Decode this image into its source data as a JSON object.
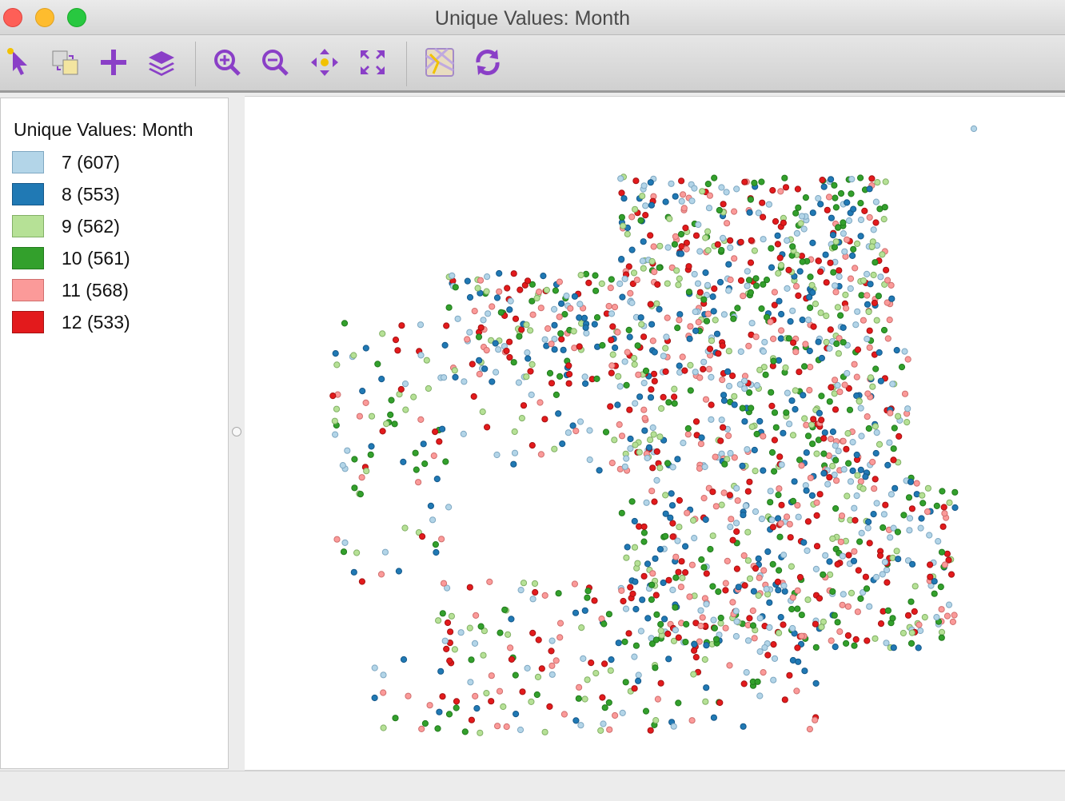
{
  "window": {
    "title": "Unique Values: Month"
  },
  "toolbar": {
    "buttons": [
      {
        "name": "select-tool",
        "icon": "pointer-icon"
      },
      {
        "name": "copy-tool",
        "icon": "copy-image-icon"
      },
      {
        "name": "add-layer",
        "icon": "plus-icon"
      },
      {
        "name": "layers",
        "icon": "layers-icon"
      },
      {
        "name": "zoom-in",
        "icon": "zoom-in-icon"
      },
      {
        "name": "zoom-out",
        "icon": "zoom-out-icon"
      },
      {
        "name": "pan",
        "icon": "pan-icon"
      },
      {
        "name": "full-extent",
        "icon": "fit-extent-icon"
      },
      {
        "name": "basemap",
        "icon": "basemap-icon"
      },
      {
        "name": "refresh",
        "icon": "refresh-icon"
      }
    ]
  },
  "legend": {
    "title": "Unique Values: Month",
    "items": [
      {
        "label": "7 (607)",
        "value": 7,
        "count": 607,
        "color": "#b3d5e8",
        "stroke": "#7fa8c2"
      },
      {
        "label": "8 (553)",
        "value": 8,
        "count": 553,
        "color": "#2079b4",
        "stroke": "#15588a"
      },
      {
        "label": "9 (562)",
        "value": 9,
        "count": 562,
        "color": "#b6e196",
        "stroke": "#82b066"
      },
      {
        "label": "10 (561)",
        "value": 10,
        "count": 561,
        "color": "#33a02c",
        "stroke": "#227a1d"
      },
      {
        "label": "11 (568)",
        "value": 11,
        "count": 568,
        "color": "#fb9a99",
        "stroke": "#d06f6e"
      },
      {
        "label": "12 (533)",
        "value": 12,
        "count": 533,
        "color": "#e31a1c",
        "stroke": "#a51213"
      }
    ]
  },
  "colors": {
    "accent": "#8a3fc7",
    "tool-yellow": "#f2c200"
  }
}
